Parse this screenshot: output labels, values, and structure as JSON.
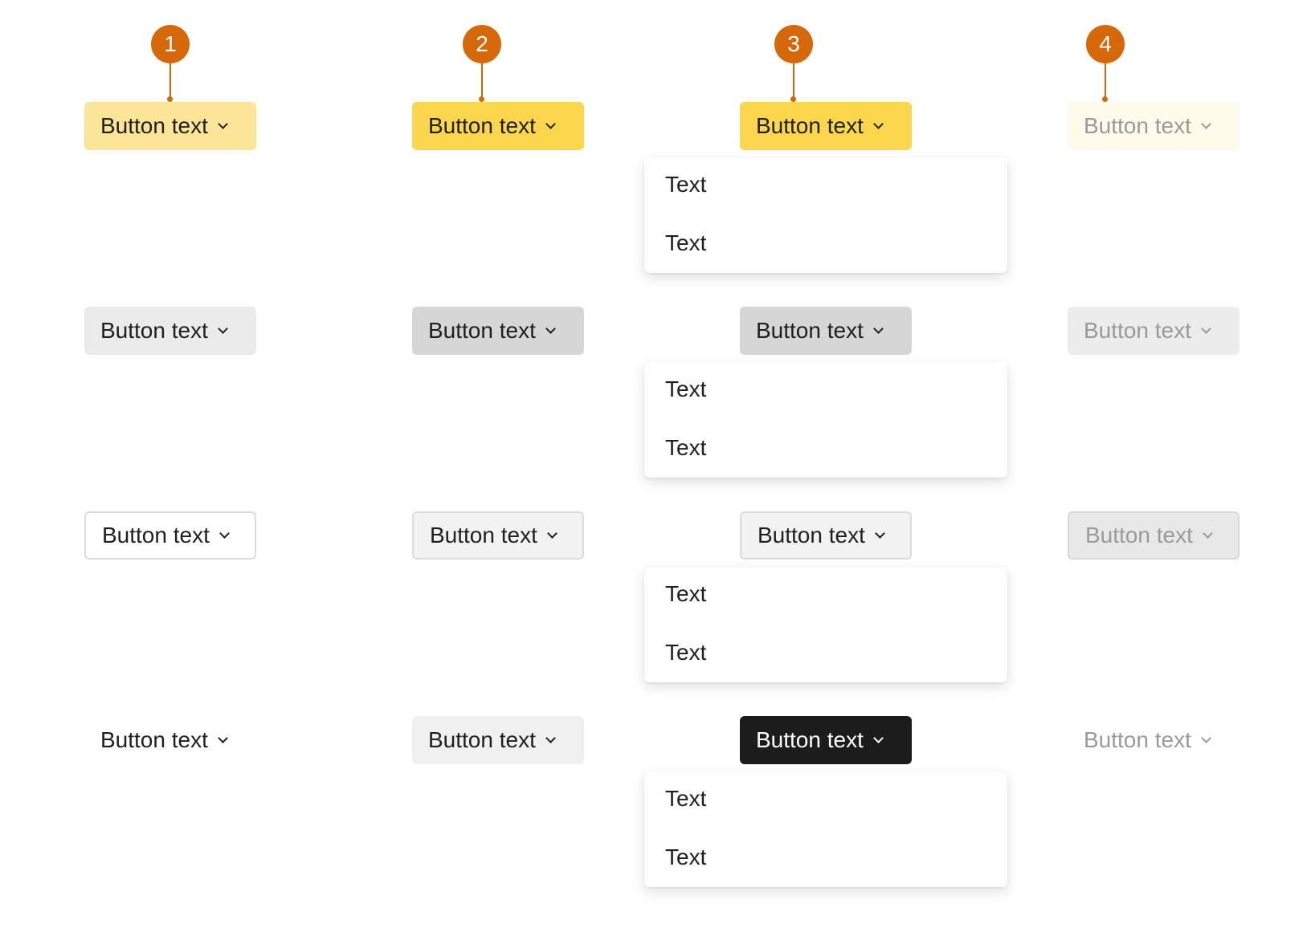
{
  "markers": [
    "1",
    "2",
    "3",
    "4"
  ],
  "button_label": "Button text",
  "menu_items": [
    "Text",
    "Text"
  ],
  "colors": {
    "marker": "#d4680b",
    "yellow_default": "#fde597",
    "yellow_hover": "#fcd64d",
    "yellow_disabled": "#fffbea",
    "gray_default": "#ebebeb",
    "gray_hover": "#d6d6d6",
    "dark_active": "#1c1c1c"
  },
  "rows": [
    {
      "variant": "primary-yellow",
      "states": [
        {
          "state": "default",
          "label": "Button text"
        },
        {
          "state": "hover",
          "label": "Button text"
        },
        {
          "state": "open",
          "label": "Button text",
          "menu": [
            "Text",
            "Text"
          ]
        },
        {
          "state": "disabled",
          "label": "Button text"
        }
      ]
    },
    {
      "variant": "secondary-gray",
      "states": [
        {
          "state": "default",
          "label": "Button text"
        },
        {
          "state": "hover",
          "label": "Button text"
        },
        {
          "state": "open",
          "label": "Button text",
          "menu": [
            "Text",
            "Text"
          ]
        },
        {
          "state": "disabled",
          "label": "Button text"
        }
      ]
    },
    {
      "variant": "outline",
      "states": [
        {
          "state": "default",
          "label": "Button text"
        },
        {
          "state": "hover",
          "label": "Button text"
        },
        {
          "state": "open",
          "label": "Button text",
          "menu": [
            "Text",
            "Text"
          ]
        },
        {
          "state": "disabled",
          "label": "Button text"
        }
      ]
    },
    {
      "variant": "ghost",
      "states": [
        {
          "state": "default",
          "label": "Button text"
        },
        {
          "state": "hover",
          "label": "Button text"
        },
        {
          "state": "open-dark",
          "label": "Button text",
          "menu": [
            "Text",
            "Text"
          ]
        },
        {
          "state": "disabled",
          "label": "Button text"
        }
      ]
    }
  ]
}
